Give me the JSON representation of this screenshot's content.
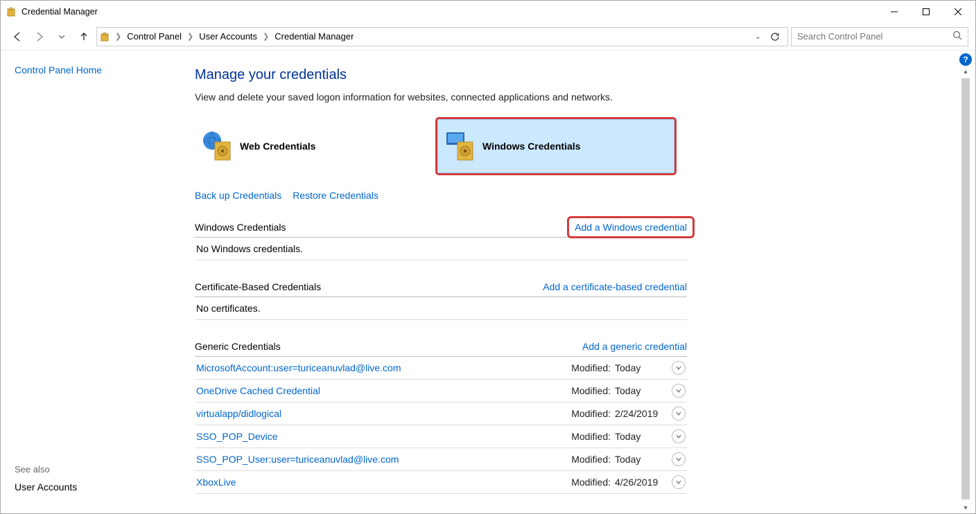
{
  "window": {
    "title": "Credential Manager"
  },
  "breadcrumb": {
    "items": [
      "Control Panel",
      "User Accounts",
      "Credential Manager"
    ]
  },
  "search": {
    "placeholder": "Search Control Panel"
  },
  "sidebar": {
    "home_link": "Control Panel Home",
    "seealso_label": "See also",
    "useraccounts_link": "User Accounts"
  },
  "main": {
    "heading": "Manage your credentials",
    "description": "View and delete your saved logon information for websites, connected applications and networks.",
    "tiles": {
      "web": "Web Credentials",
      "windows": "Windows Credentials"
    },
    "links": {
      "backup": "Back up Credentials",
      "restore": "Restore Credentials"
    },
    "sections": {
      "windows": {
        "title": "Windows Credentials",
        "add_link": "Add a Windows credential",
        "empty_text": "No Windows credentials."
      },
      "cert": {
        "title": "Certificate-Based Credentials",
        "add_link": "Add a certificate-based credential",
        "empty_text": "No certificates."
      },
      "generic": {
        "title": "Generic Credentials",
        "add_link": "Add a generic credential",
        "modified_label": "Modified:",
        "rows": [
          {
            "name": "MicrosoftAccount:user=turiceanuvlad@live.com",
            "modified": "Today"
          },
          {
            "name": "OneDrive Cached Credential",
            "modified": "Today"
          },
          {
            "name": "virtualapp/didlogical",
            "modified": "2/24/2019"
          },
          {
            "name": "SSO_POP_Device",
            "modified": "Today"
          },
          {
            "name": "SSO_POP_User:user=turiceanuvlad@live.com",
            "modified": "Today"
          },
          {
            "name": "XboxLive",
            "modified": "4/26/2019"
          }
        ]
      }
    }
  }
}
